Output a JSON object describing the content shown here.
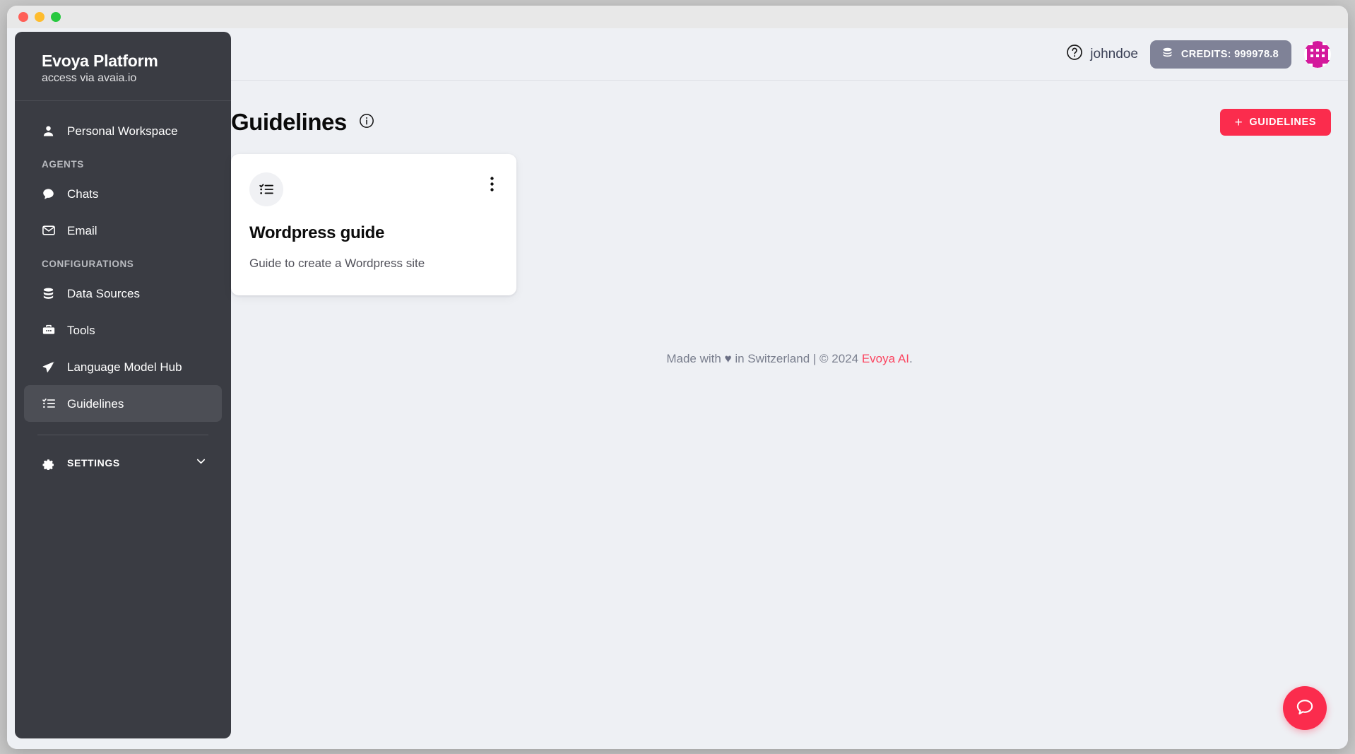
{
  "window": {
    "traffic_lights": [
      "close",
      "minimize",
      "zoom"
    ]
  },
  "sidebar": {
    "brand": {
      "title": "Evoya Platform",
      "subtitle": "access via avaia.io"
    },
    "workspace": {
      "label": "Personal Workspace",
      "icon": "person-icon"
    },
    "sections": [
      {
        "label": "AGENTS",
        "items": [
          {
            "label": "Chats",
            "icon": "chat-bubble-icon",
            "active": false
          },
          {
            "label": "Email",
            "icon": "envelope-icon",
            "active": false
          }
        ]
      },
      {
        "label": "CONFIGURATIONS",
        "items": [
          {
            "label": "Data Sources",
            "icon": "database-icon",
            "active": false
          },
          {
            "label": "Tools",
            "icon": "toolbox-icon",
            "active": false
          },
          {
            "label": "Language Model Hub",
            "icon": "paper-plane-icon",
            "active": false
          },
          {
            "label": "Guidelines",
            "icon": "checklist-icon",
            "active": true
          }
        ]
      }
    ],
    "settings": {
      "label": "SETTINGS",
      "icon": "gear-icon",
      "chevron": "chevron-down-icon"
    }
  },
  "topbar": {
    "help_icon": "question-circle-icon",
    "username": "johndoe",
    "credits_icon": "coins-icon",
    "credits_label": "CREDITS: 999978.8",
    "avatar": "identicon-avatar"
  },
  "page": {
    "title": "Guidelines",
    "info_icon": "info-circle-icon",
    "add_button": {
      "plus": "+",
      "label": "GUIDELINES"
    }
  },
  "cards": [
    {
      "icon": "checklist-icon",
      "menu_icon": "kebab-menu-icon",
      "title": "Wordpress guide",
      "description": "Guide to create a Wordpress site"
    }
  ],
  "footer": {
    "prefix": "Made with ",
    "heart": "♥",
    "middle": " in Switzerland | © 2024 ",
    "link": "Evoya AI",
    "suffix": "."
  },
  "fab": {
    "icon": "chat-bubble-icon"
  },
  "colors": {
    "accent": "#fb2c4d",
    "sidebar_bg": "#3a3c43",
    "page_bg": "#eef0f4",
    "credits_bg": "#7f8297",
    "avatar": "#d4199c"
  }
}
